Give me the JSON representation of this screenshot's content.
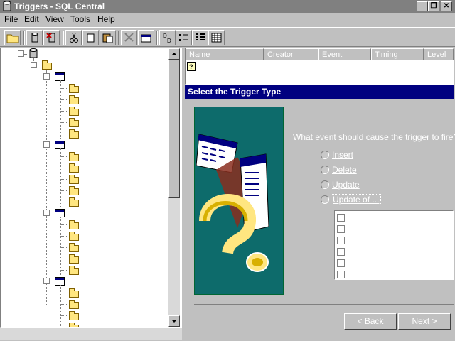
{
  "window": {
    "title": "Triggers - SQL Central"
  },
  "title_buttons": {
    "minimize": "_",
    "restore": "❐",
    "close": "✕"
  },
  "menus": [
    "File",
    "Edit",
    "View",
    "Tools",
    "Help"
  ],
  "toolbar": {
    "buttons": [
      "open-folder-icon",
      "database-icon",
      "delete-database-icon",
      "cut-icon",
      "copy-icon",
      "paste-icon",
      "delete-icon",
      "properties-icon",
      "large-icons-icon",
      "small-icons-icon",
      "list-view-icon",
      "details-view-icon"
    ]
  },
  "tree": {
    "groups": [
      {
        "folders": 5
      },
      {
        "folders": 5
      },
      {
        "folders": 5
      },
      {
        "folders": 4
      }
    ]
  },
  "list": {
    "columns": [
      "Name",
      "Creator",
      "Event",
      "Timing",
      "Level"
    ]
  },
  "wizard": {
    "title": "Select the Trigger Type",
    "question": "What event should cause the trigger to fire?",
    "options": [
      {
        "label": "Insert"
      },
      {
        "label": "Delete"
      },
      {
        "label": "Update"
      },
      {
        "label": "Update of ..."
      }
    ],
    "column_checkbox_count": 6,
    "buttons": {
      "back": "< Back",
      "next": "Next >"
    }
  },
  "colors": {
    "title_bar": "#808080",
    "wizard_title": "#000080",
    "art_background": "#0d6b6b"
  }
}
